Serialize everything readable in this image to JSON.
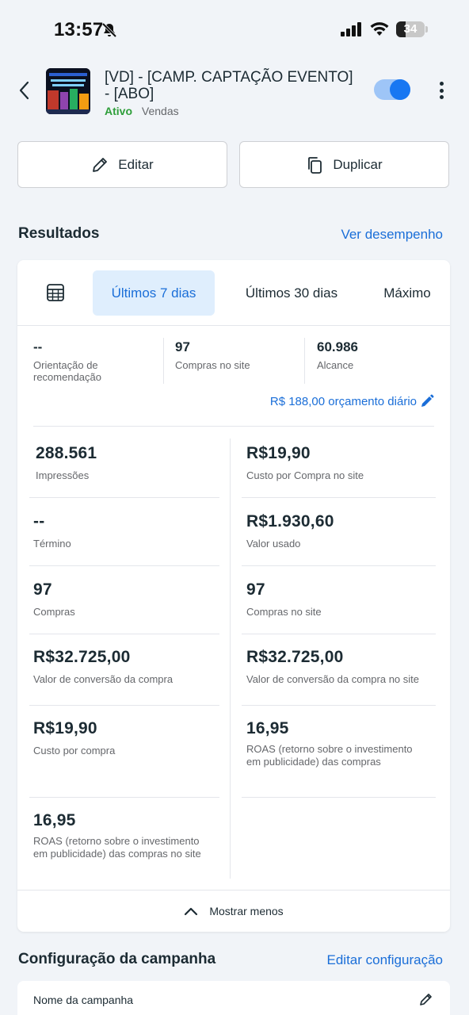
{
  "status_bar": {
    "time": "13:57",
    "battery_level": "34",
    "battery_fraction": 0.34
  },
  "header": {
    "title": "[VD] - [CAMP. CAPTAÇÃO EVENTO] - [ABO]",
    "status": "Ativo",
    "objective": "Vendas",
    "toggle_on": true
  },
  "actions": {
    "edit_label": "Editar",
    "duplicate_label": "Duplicar"
  },
  "results": {
    "title": "Resultados",
    "link": "Ver desempenho",
    "tabs": [
      {
        "label": "Últimos 7 dias",
        "selected": true
      },
      {
        "label": "Últimos 30 dias",
        "selected": false
      },
      {
        "label": "Máximo",
        "selected": false
      }
    ],
    "summary": [
      {
        "value": "--",
        "label": "Orientação de recomendação"
      },
      {
        "value": "97",
        "label": "Compras no site"
      },
      {
        "value": "60.986",
        "label": "Alcance"
      }
    ],
    "budget": "R$ 188,00 orçamento diário",
    "metrics_left": [
      {
        "value": "288.561",
        "label": "Impressões"
      },
      {
        "value": "--",
        "label": "Término"
      },
      {
        "value": "97",
        "label": "Compras"
      },
      {
        "value": "R$32.725,00",
        "label": "Valor de conversão da compra"
      },
      {
        "value": "R$19,90",
        "label": "Custo por compra"
      },
      {
        "value": "16,95",
        "label": "ROAS (retorno sobre o investimento em publicidade) das compras no site"
      }
    ],
    "metrics_right": [
      {
        "value": "R$19,90",
        "label": "Custo por Compra no site"
      },
      {
        "value": "R$1.930,60",
        "label": "Valor usado"
      },
      {
        "value": "97",
        "label": "Compras no site"
      },
      {
        "value": "R$32.725,00",
        "label": "Valor de conversão da compra no site"
      },
      {
        "value": "16,95",
        "label": "ROAS (retorno sobre o investimento em publicidade) das compras"
      }
    ],
    "show_less": "Mostrar menos"
  },
  "config": {
    "title": "Configuração da campanha",
    "link": "Editar configuração",
    "name_label": "Nome da campanha"
  },
  "colors": {
    "accent": "#1a6ed8",
    "active_green": "#2e9e3a",
    "toggle": "#1877f2"
  }
}
